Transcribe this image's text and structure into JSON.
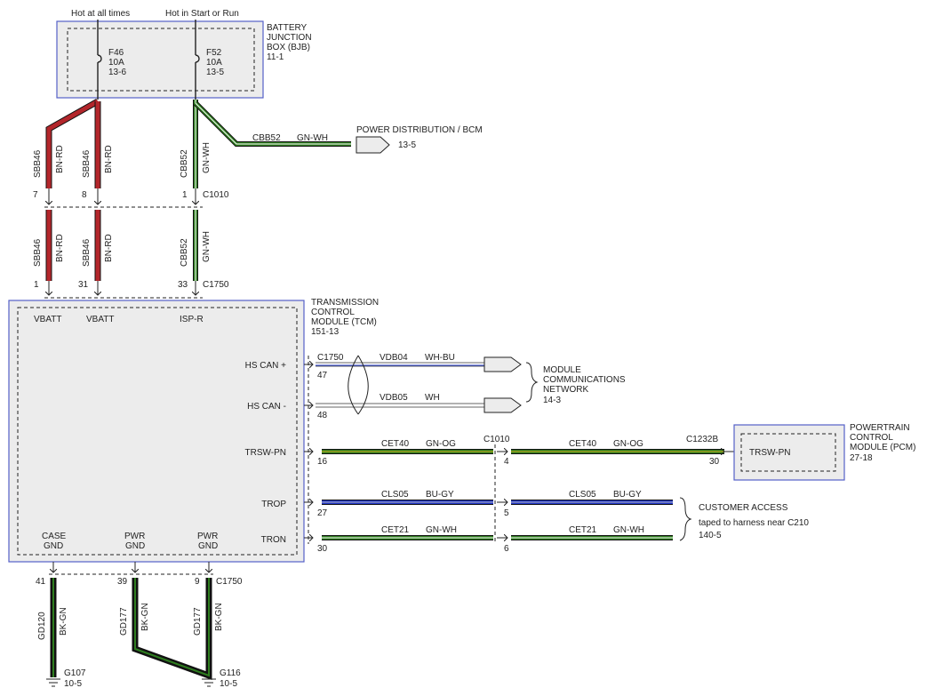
{
  "top": {
    "hot_all": "Hot at all times",
    "hot_start": "Hot in Start or Run"
  },
  "bjb": {
    "title": [
      "BATTERY",
      "JUNCTION",
      "BOX (BJB)",
      "11-1"
    ],
    "fuse1": [
      "F46",
      "10A",
      "13-6"
    ],
    "fuse2": [
      "F52",
      "10A",
      "13-5"
    ]
  },
  "pdb": {
    "wire": "CBB52",
    "color": "GN-WH",
    "title": "POWER DISTRIBUTION / BCM",
    "ref": "13-5"
  },
  "upper_wires": [
    {
      "circuit": "SBB46",
      "color": "BN-RD",
      "pin": "7"
    },
    {
      "circuit": "SBB46",
      "color": "BN-RD",
      "pin": "8"
    },
    {
      "circuit": "CBB52",
      "color": "GN-WH",
      "pin": "1"
    }
  ],
  "c1010_top": "C1010",
  "lower_wires": [
    {
      "circuit": "SBB46",
      "color": "BN-RD",
      "pin": "1"
    },
    {
      "circuit": "SBB46",
      "color": "BN-RD",
      "pin": "31"
    },
    {
      "circuit": "CBB52",
      "color": "GN-WH",
      "pin": "33"
    }
  ],
  "c1750": "C1750",
  "tcm": {
    "title": [
      "TRANSMISSION",
      "CONTROL",
      "MODULE (TCM)",
      "151-13"
    ],
    "top_pins": [
      "VBATT",
      "VBATT",
      "ISP-R"
    ],
    "right_pins": [
      "HS CAN +",
      "HS CAN -",
      "TRSW-PN",
      "TROP",
      "TRON"
    ],
    "bottom_pins": [
      [
        "CASE",
        "GND"
      ],
      [
        "PWR",
        "GND"
      ],
      [
        "PWR",
        "GND"
      ]
    ]
  },
  "can": {
    "c1750": "C1750",
    "rows": [
      {
        "pin": "47",
        "circuit": "VDB04",
        "color": "WH-BU"
      },
      {
        "pin": "48",
        "circuit": "VDB05",
        "color": "WH"
      }
    ],
    "network": [
      "MODULE",
      "COMMUNICATIONS",
      "NETWORK",
      "14-3"
    ]
  },
  "signals": [
    {
      "pin": "16",
      "circuit": "CET40",
      "color": "GN-OG",
      "mid_pin": "4",
      "circuit2": "CET40",
      "color2": "GN-OG"
    },
    {
      "pin": "27",
      "circuit": "CLS05",
      "color": "BU-GY",
      "mid_pin": "5",
      "circuit2": "CLS05",
      "color2": "BU-GY"
    },
    {
      "pin": "30",
      "circuit": "CET21",
      "color": "GN-WH",
      "mid_pin": "6",
      "circuit2": "CET21",
      "color2": "GN-WH"
    }
  ],
  "c1010_mid": "C1010",
  "c1232b": {
    "connector": "C1232B",
    "pin": "30"
  },
  "pcm": {
    "title": [
      "POWERTRAIN",
      "CONTROL",
      "MODULE (PCM)",
      "27-18"
    ],
    "pin": "TRSW-PN"
  },
  "customer": {
    "title": "CUSTOMER ACCESS",
    "note": "taped to harness near C210",
    "ref": "140-5"
  },
  "grounds": [
    {
      "pin": "41",
      "circuit": "GD120",
      "color": "BK-GN"
    },
    {
      "pin": "39",
      "circuit": "GD177",
      "color": "BK-GN"
    },
    {
      "pin": "9",
      "circuit": "GD177",
      "color": "BK-GN"
    }
  ],
  "g_c1750": "C1750",
  "g107": [
    "G107",
    "10-5"
  ],
  "g116": [
    "G116",
    "10-5"
  ],
  "colors": {
    "red": "#b3262b",
    "green": "#2e7d1f",
    "blue": "#1f35c8",
    "olive": "#b8a020",
    "black": "#111111",
    "module": "#ececec",
    "outline": "#5560c8"
  }
}
